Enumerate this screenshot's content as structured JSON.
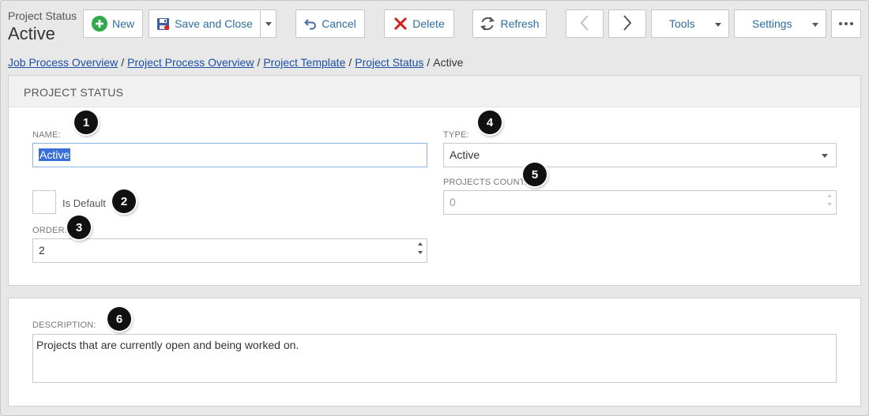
{
  "header": {
    "record_type": "Project Status",
    "record_name": "Active"
  },
  "toolbar": {
    "new_label": "New",
    "save_close_label": "Save and Close",
    "cancel_label": "Cancel",
    "delete_label": "Delete",
    "refresh_label": "Refresh",
    "tools_label": "Tools",
    "settings_label": "Settings"
  },
  "breadcrumb": {
    "items": [
      "Job Process Overview",
      "Project Process Overview",
      "Project Template",
      "Project Status"
    ],
    "separator": "/",
    "current": "Active"
  },
  "section": {
    "title": "PROJECT STATUS"
  },
  "form": {
    "name_label": "NAME:",
    "name_value": "Active",
    "is_default_label": "Is Default",
    "is_default_checked": false,
    "order_label": "ORDER:",
    "order_value": "2",
    "type_label": "TYPE:",
    "type_value": "Active",
    "projects_count_label": "PROJECTS COUNT:",
    "projects_count_value": "0",
    "description_label": "DESCRIPTION:",
    "description_value": "Projects that are currently open and being worked on."
  },
  "markers": [
    "1",
    "2",
    "3",
    "4",
    "5",
    "6"
  ],
  "colors": {
    "link": "#1a4fa3",
    "button_text": "#2d6da3",
    "new_icon": "#2eaa4a",
    "delete_icon": "#d02020",
    "selection": "#3a6fd8",
    "marker": "#111111"
  }
}
